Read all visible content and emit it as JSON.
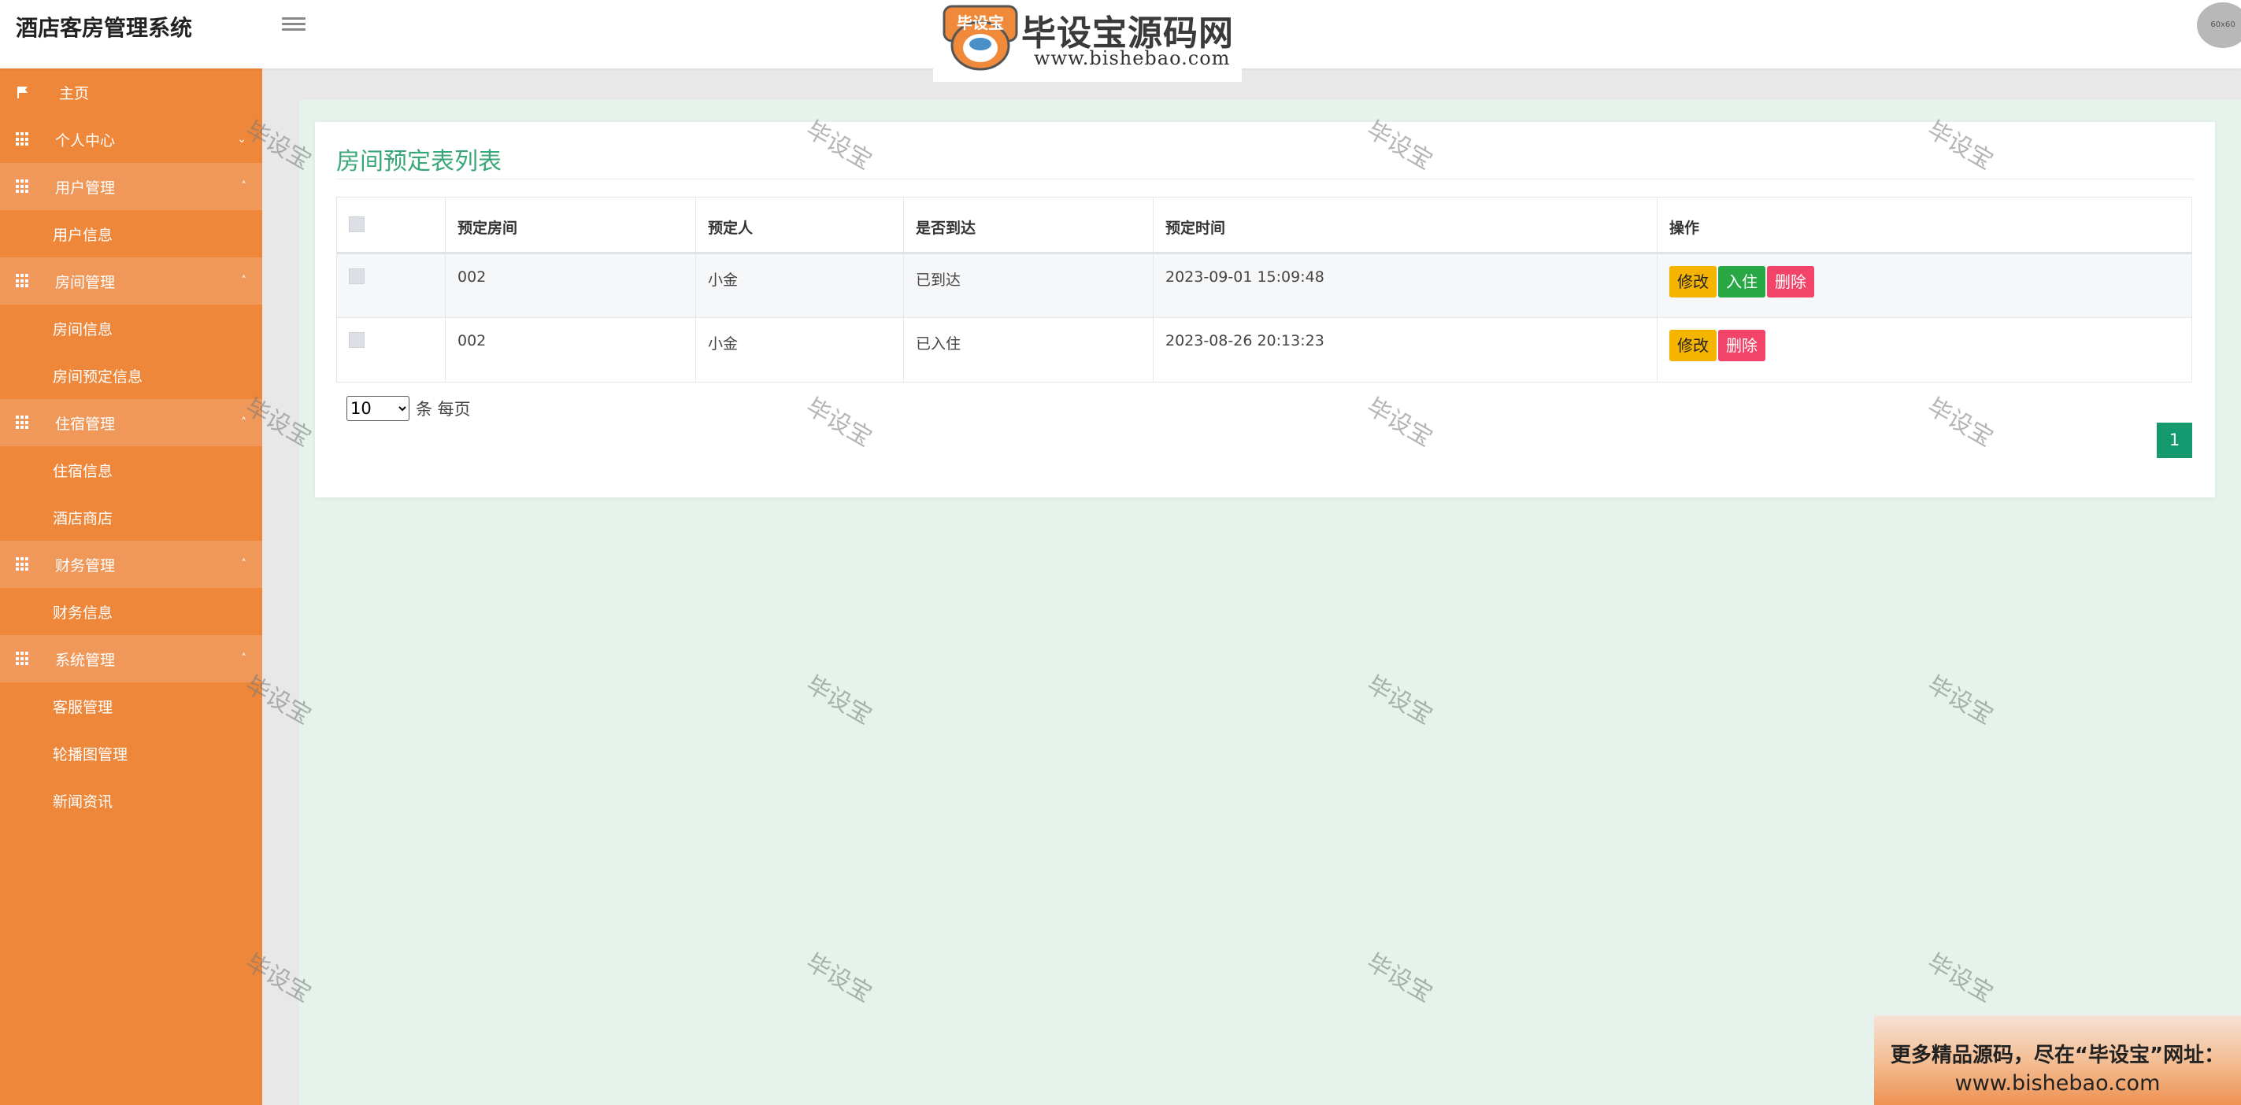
{
  "header": {
    "app_title": "酒店客房管理系统",
    "logo_text": "毕设宝源码网",
    "logo_badge": "毕设宝",
    "logo_url": "www.bishebao.com",
    "avatar_label": "60x60"
  },
  "sidebar": {
    "home": "主页",
    "personal": "个人中心",
    "user_mgmt": "用户管理",
    "user_info": "用户信息",
    "room_mgmt": "房间管理",
    "room_info": "房间信息",
    "room_booking_info": "房间预定信息",
    "stay_mgmt": "住宿管理",
    "stay_info": "住宿信息",
    "hotel_shop": "酒店商店",
    "finance_mgmt": "财务管理",
    "finance_info": "财务信息",
    "system_mgmt": "系统管理",
    "service_mgmt": "客服管理",
    "carousel_mgmt": "轮播图管理",
    "news": "新闻资讯"
  },
  "panel": {
    "title": "房间预定表列表",
    "columns": {
      "room": "预定房间",
      "person": "预定人",
      "arrived": "是否到达",
      "time": "预定时间",
      "ops": "操作"
    },
    "rows": [
      {
        "room": "002",
        "person": "小金",
        "arrived": "已到达",
        "time": "2023-09-01 15:09:48"
      },
      {
        "room": "002",
        "person": "小金",
        "arrived": "已入住",
        "time": "2023-08-26 20:13:23"
      }
    ],
    "buttons": {
      "edit": "修改",
      "checkin": "入住",
      "delete": "删除"
    },
    "page_size": "10",
    "page_size_suffix": "条 每页",
    "current_page": "1"
  },
  "watermark": "毕设宝",
  "ad": {
    "line1": "更多精品源码，尽在“毕设宝”网址：",
    "line2": "www.bishebao.com"
  },
  "colors": {
    "sidebar": "#ee873a",
    "accent_green": "#149a6e",
    "content_bg": "#e5f3ec"
  }
}
